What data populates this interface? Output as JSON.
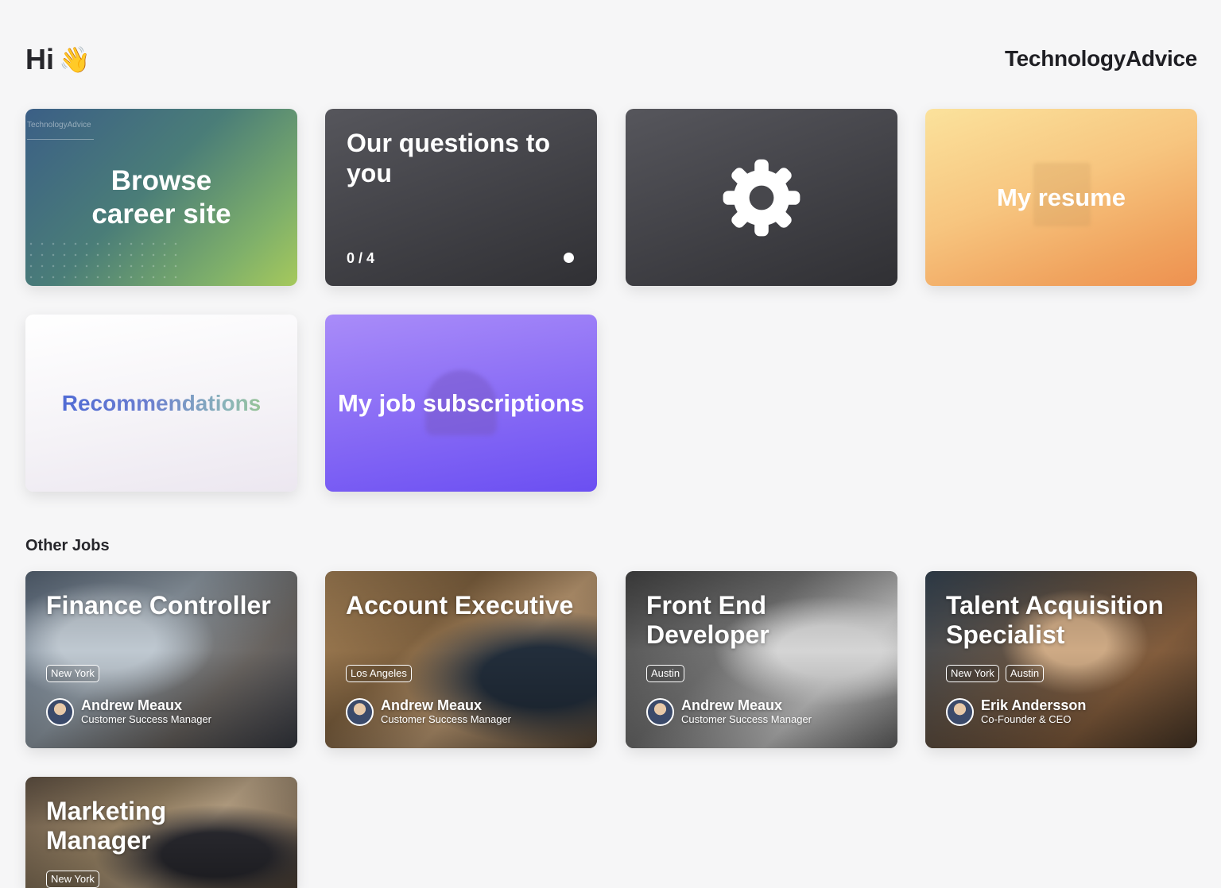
{
  "header": {
    "greeting": "Hi",
    "wave_emoji": "👋",
    "brand": "TechnologyAdvice"
  },
  "tiles": {
    "browse": {
      "title": "Browse career site",
      "mini_brand": "TechnologyAdvice"
    },
    "questions": {
      "title": "Our questions to you",
      "progress": "0 / 4"
    },
    "settings": {
      "icon": "gear-icon"
    },
    "resume": {
      "title": "My resume"
    },
    "recommendations": {
      "title": "Recommendations"
    },
    "subscriptions": {
      "title": "My job subscriptions"
    }
  },
  "other_jobs": {
    "heading": "Other Jobs",
    "jobs": [
      {
        "title": "Finance Controller",
        "tags": [
          "New York"
        ],
        "person": "Andrew Meaux",
        "role": "Customer Success Manager"
      },
      {
        "title": "Account Executive",
        "tags": [
          "Los Angeles"
        ],
        "person": "Andrew Meaux",
        "role": "Customer Success Manager"
      },
      {
        "title": "Front End Developer",
        "tags": [
          "Austin"
        ],
        "person": "Andrew Meaux",
        "role": "Customer Success Manager"
      },
      {
        "title": "Talent Acquisition Specialist",
        "tags": [
          "New York",
          "Austin"
        ],
        "person": "Erik Andersson",
        "role": "Co-Founder & CEO"
      },
      {
        "title": "Marketing Manager",
        "tags": [
          "New York"
        ]
      }
    ]
  },
  "colors": {
    "background": "#f6f6f7",
    "dark_tile": "#45454a",
    "purple": "#7a5cf4",
    "orange": "#f0a35e"
  }
}
